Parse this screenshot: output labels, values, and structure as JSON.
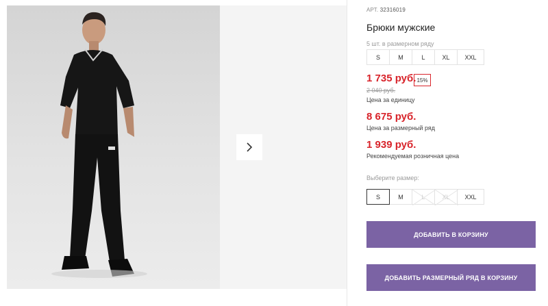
{
  "product": {
    "article_prefix": "АРТ.",
    "article_number": "32316019",
    "title": "Брюки мужские",
    "set_note": "5 шт. в размерном ряду",
    "set_sizes": [
      "S",
      "M",
      "L",
      "XL",
      "XXL"
    ],
    "price_unit": "1 735 руб.",
    "discount_badge": "15%",
    "price_old": "2 040 руб.",
    "price_unit_label": "Цена за единицу",
    "price_set": "8 675 руб.",
    "price_set_label": "Цена за размерный ряд",
    "price_retail": "1 939 руб.",
    "price_retail_label": "Рекомендуемая розничная цена",
    "choose_size_label": "Выберите размер:",
    "size_options": [
      {
        "label": "S",
        "state": "selected"
      },
      {
        "label": "M",
        "state": "available"
      },
      {
        "label": "L",
        "state": "unavailable"
      },
      {
        "label": "XL",
        "state": "unavailable"
      },
      {
        "label": "XXL",
        "state": "available"
      }
    ],
    "add_to_cart_label": "ДОБАВИТЬ В КОРЗИНУ",
    "add_set_to_cart_label": "ДОБАВИТЬ РАЗМЕРНЫЙ РЯД В КОРЗИНУ"
  },
  "gallery": {
    "next_icon": "chevron-right-icon"
  },
  "colors": {
    "price_red": "#d8232a",
    "button_purple": "#7b63a4"
  }
}
